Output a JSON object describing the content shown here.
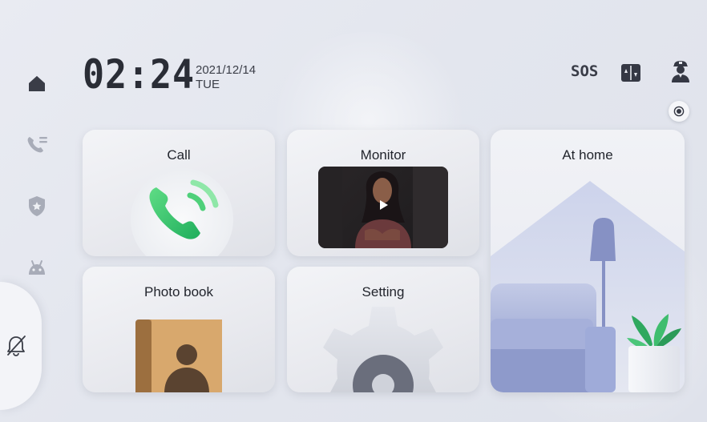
{
  "header": {
    "time": "02:24",
    "date": "2021/12/14",
    "day": "TUE",
    "sos_label": "SOS"
  },
  "sidebar": {
    "items": [
      {
        "name": "home",
        "icon": "home-icon"
      },
      {
        "name": "call-log",
        "icon": "phone-list-icon"
      },
      {
        "name": "security",
        "icon": "shield-star-icon"
      },
      {
        "name": "android",
        "icon": "android-icon"
      },
      {
        "name": "do-not-disturb",
        "icon": "no-disturb-icon"
      }
    ]
  },
  "top_icons": [
    "sos-icon",
    "door-panel-icon",
    "security-guard-icon",
    "record-icon"
  ],
  "cards": {
    "call": {
      "title": "Call"
    },
    "monitor": {
      "title": "Monitor"
    },
    "at_home": {
      "title": "At home"
    },
    "photo_book": {
      "title": "Photo book"
    },
    "setting": {
      "title": "Setting"
    }
  },
  "colors": {
    "call_green": "#2fbf6a",
    "text_dark": "#22252d",
    "accent_blue": "#a7b3dd"
  }
}
